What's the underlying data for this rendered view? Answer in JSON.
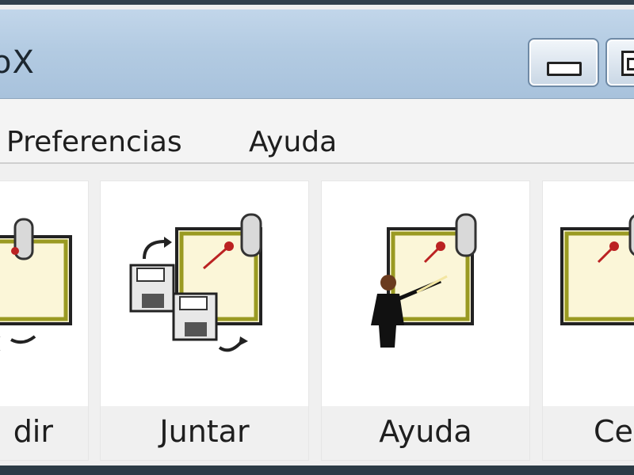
{
  "window": {
    "title": "oX"
  },
  "menu": {
    "items": [
      "Preferencias",
      "Ayuda"
    ]
  },
  "tiles": [
    {
      "label": "dir",
      "icon": "split-files-icon"
    },
    {
      "label": "Juntar",
      "icon": "merge-files-icon"
    },
    {
      "label": "Ayuda",
      "icon": "presenter-help-icon"
    },
    {
      "label": "Ce",
      "icon": "close-board-icon"
    }
  ],
  "colors": {
    "titlebar": "#b3cbe2",
    "menubar": "#f4f4f4",
    "tile_bg": "#ffffff"
  }
}
